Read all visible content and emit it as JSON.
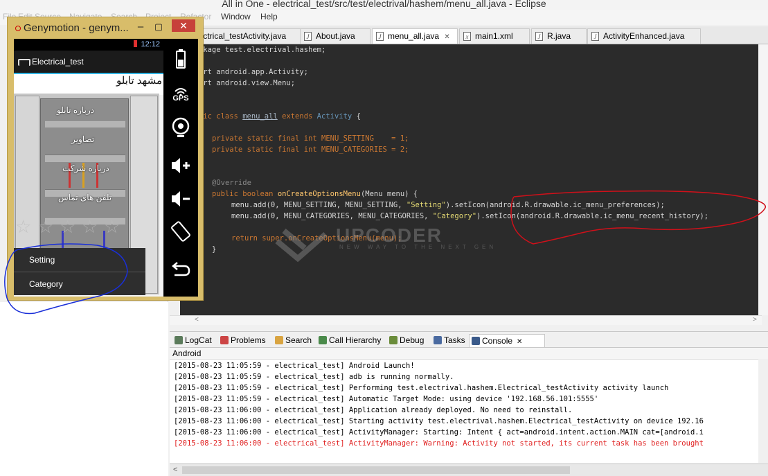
{
  "eclipse": {
    "window_title": "All in One - electrical_test/src/test/electrival/hashem/menu_all.java - Eclipse",
    "menu": [
      "File",
      "Edit",
      "Source",
      "Navigate",
      "Search",
      "Project",
      "Refactor",
      "Window",
      "Help"
    ],
    "editor_tabs": [
      {
        "label": "Electrical_testActivity.java",
        "icon": "J"
      },
      {
        "label": "About.java",
        "icon": "J"
      },
      {
        "label": "menu_all.java",
        "icon": "J",
        "active": true
      },
      {
        "label": "main1.xml",
        "icon": "x"
      },
      {
        "label": "R.java",
        "icon": "J"
      },
      {
        "label": "ActivityEnhanced.java",
        "icon": "J"
      }
    ],
    "code": {
      "l1": "package test.electrival.hashem;",
      "l2": "import android.app.Activity;",
      "l3": "import android.view.Menu;",
      "l4_kw": "public class ",
      "l4_name": "menu_all",
      "l4_kw2": " extends ",
      "l4_base": "Activity",
      "l4_end": " {",
      "l5": "private static final int MENU_SETTING    = 1;",
      "l6": "private static final int MENU_CATEGORIES = 2;",
      "l7": "@Override",
      "l8_a": "public boolean ",
      "l8_b": "onCreateOptionsMenu",
      "l8_c": "(Menu menu) {",
      "l9_a": "menu.add(0, MENU_SETTING, MENU_SETTING, ",
      "l9_str": "\"Setting\"",
      "l9_b": ").setIcon(android.R.drawable.ic_menu_preferences);",
      "l10_a": "menu.add(0, MENU_CATEGORIES, MENU_CATEGORIES, ",
      "l10_str": "\"Category\"",
      "l10_b": ").setIcon(android.R.drawable.ic_menu_recent_history);",
      "l11": "return super.onCreateOptionsMenu(menu);",
      "l12": "}"
    },
    "watermark": {
      "title": "UPCODER",
      "tagline": "NEW WAY TO THE NEXT GEN"
    },
    "view_tabs": [
      "LogCat",
      "Problems",
      "Search",
      "Call Hierarchy",
      "Debug",
      "Tasks",
      "Console"
    ],
    "active_view": "Console",
    "console_name": "Android",
    "console_lines": [
      {
        "text": "[2015-08-23 11:05:59 - electrical_test] Android Launch!",
        "error": false
      },
      {
        "text": "[2015-08-23 11:05:59 - electrical_test] adb is running normally.",
        "error": false
      },
      {
        "text": "[2015-08-23 11:05:59 - electrical_test] Performing test.electrival.hashem.Electrical_testActivity activity launch",
        "error": false
      },
      {
        "text": "[2015-08-23 11:05:59 - electrical_test] Automatic Target Mode: using device '192.168.56.101:5555'",
        "error": false
      },
      {
        "text": "[2015-08-23 11:06:00 - electrical_test] Application already deployed. No need to reinstall.",
        "error": false
      },
      {
        "text": "[2015-08-23 11:06:00 - electrical_test] Starting activity test.electrival.hashem.Electrical_testActivity on device 192.16",
        "error": false
      },
      {
        "text": "[2015-08-23 11:06:00 - electrical_test] ActivityManager: Starting: Intent { act=android.intent.action.MAIN cat=[android.i",
        "error": false
      },
      {
        "text": "[2015-08-23 11:06:00 - electrical_test] ActivityManager: Warning: Activity not started, its current task has been brought",
        "error": true
      }
    ]
  },
  "genymotion": {
    "window_title": "Genymotion - genym...",
    "status_time": "12:12",
    "app_title": "Electrical_test",
    "persian_title": "مشهد تابلو",
    "menu_fa": [
      "درباره تابلو",
      "تصاویر",
      "درباره شرکت",
      "تلفن های تماس"
    ],
    "options_menu": [
      "Setting",
      "Category"
    ],
    "side_tools": [
      "battery-icon",
      "gps-icon",
      "camera-icon",
      "volume-up-icon",
      "volume-down-icon",
      "rotate-icon",
      "back-icon"
    ],
    "gps_label": "GPS"
  },
  "colors": {
    "annotation_red": "#d0101a",
    "annotation_blue": "#1a2fd8",
    "genymotion_frame": "#d8bd6a"
  }
}
